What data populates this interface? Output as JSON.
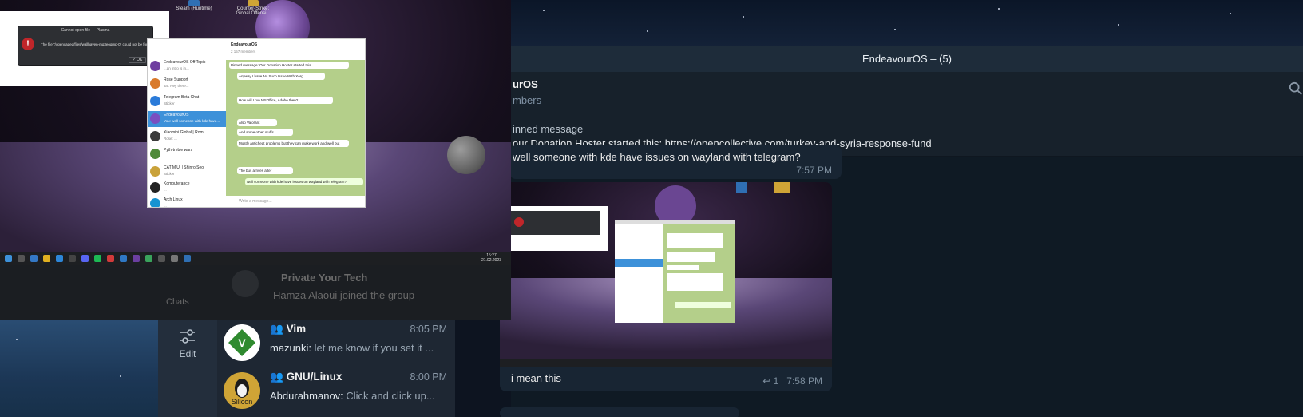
{
  "telegram_main": {
    "window_title": "EndeavourOS – (5)",
    "chat_title": "urOS",
    "chat_subtitle": "mbers",
    "pinned_title": "inned message",
    "pinned_text": "our Donation Hoster started this: https://opencollective.com/turkey-and-syria-response-fund",
    "messages": [
      {
        "text": "well someone with kde have issues on wayland with telegram?",
        "time": "7:57 PM"
      },
      {
        "text": "i mean this",
        "reply_count": "1",
        "time": "7:58 PM"
      }
    ]
  },
  "desktop": {
    "icons": [
      {
        "label": "Steam (Runtime)"
      },
      {
        "label": "Counter-Strike: Global Offensi..."
      }
    ],
    "error_dialog": {
      "title": "Cannot open file — Plasma",
      "message": "The file \"/opencaped/files/wallhaven-mq3eoqmp-0\" could not be found",
      "ok_label": "OK"
    },
    "mini_telegram": {
      "header_title": "EndeavourOS",
      "header_sub": "2 157 members",
      "chats": [
        {
          "name": "EndeavourOS Off Topic",
          "preview": "...an intro is in..."
        },
        {
          "name": "Rose Support",
          "preview": "Jai: Hey there..."
        },
        {
          "name": "Telegram Beta Chat",
          "preview": "Sticker"
        },
        {
          "name": "EndeavourOS",
          "preview": "You: well someone with kde have...",
          "active": true
        },
        {
          "name": "Xiaomini Global | Rom...",
          "preview": "Rose: ..."
        },
        {
          "name": "Pyth-treble wars",
          "preview": "..."
        },
        {
          "name": "CAT MiUI | Shinro Seo",
          "preview": "Sticker"
        },
        {
          "name": "Komputerance",
          "preview": "..."
        },
        {
          "name": "Arch Linux",
          "preview": "..."
        }
      ],
      "bubbles": [
        "Pinned message: Our Donation Hoster started this",
        "Anyway I have No Such Issue With Xorg",
        "How will I run MSOffice, Adobe then?",
        "Also Valorant",
        "And some other stuffs",
        "Mostly anticheat problems but they can make work and well but",
        "The bus arrives after",
        "well someone with kde have issues on wayland with telegram?"
      ],
      "input_placeholder": "Write a message..."
    },
    "taskbar_clock_time": "15:27",
    "taskbar_clock_date": "21.02.2023"
  },
  "ghost_overlap": {
    "chats_label": "Chats",
    "chat_name": "Private Your Tech",
    "chat_preview": "Hamza Alaoui joined the group"
  },
  "sidebar": {
    "edit_label": "Edit"
  },
  "chat_list": [
    {
      "name": "Vim",
      "time": "8:05 PM",
      "sender": "mazunki:",
      "preview": " let me know if you set it ...",
      "avatar_color": "#ffffff"
    },
    {
      "name": "GNU/Linux",
      "time": "8:00 PM",
      "sender": "Abdurahmanov:",
      "preview": " Click and click up...",
      "avatar_color": "#cfa436",
      "avatar_text": "Silicon"
    }
  ],
  "colors": {
    "telegram_dark_bg": "#17212b",
    "bubble": "#182533",
    "accent_blue": "#3d91d9",
    "error_red": "#c0262a"
  }
}
